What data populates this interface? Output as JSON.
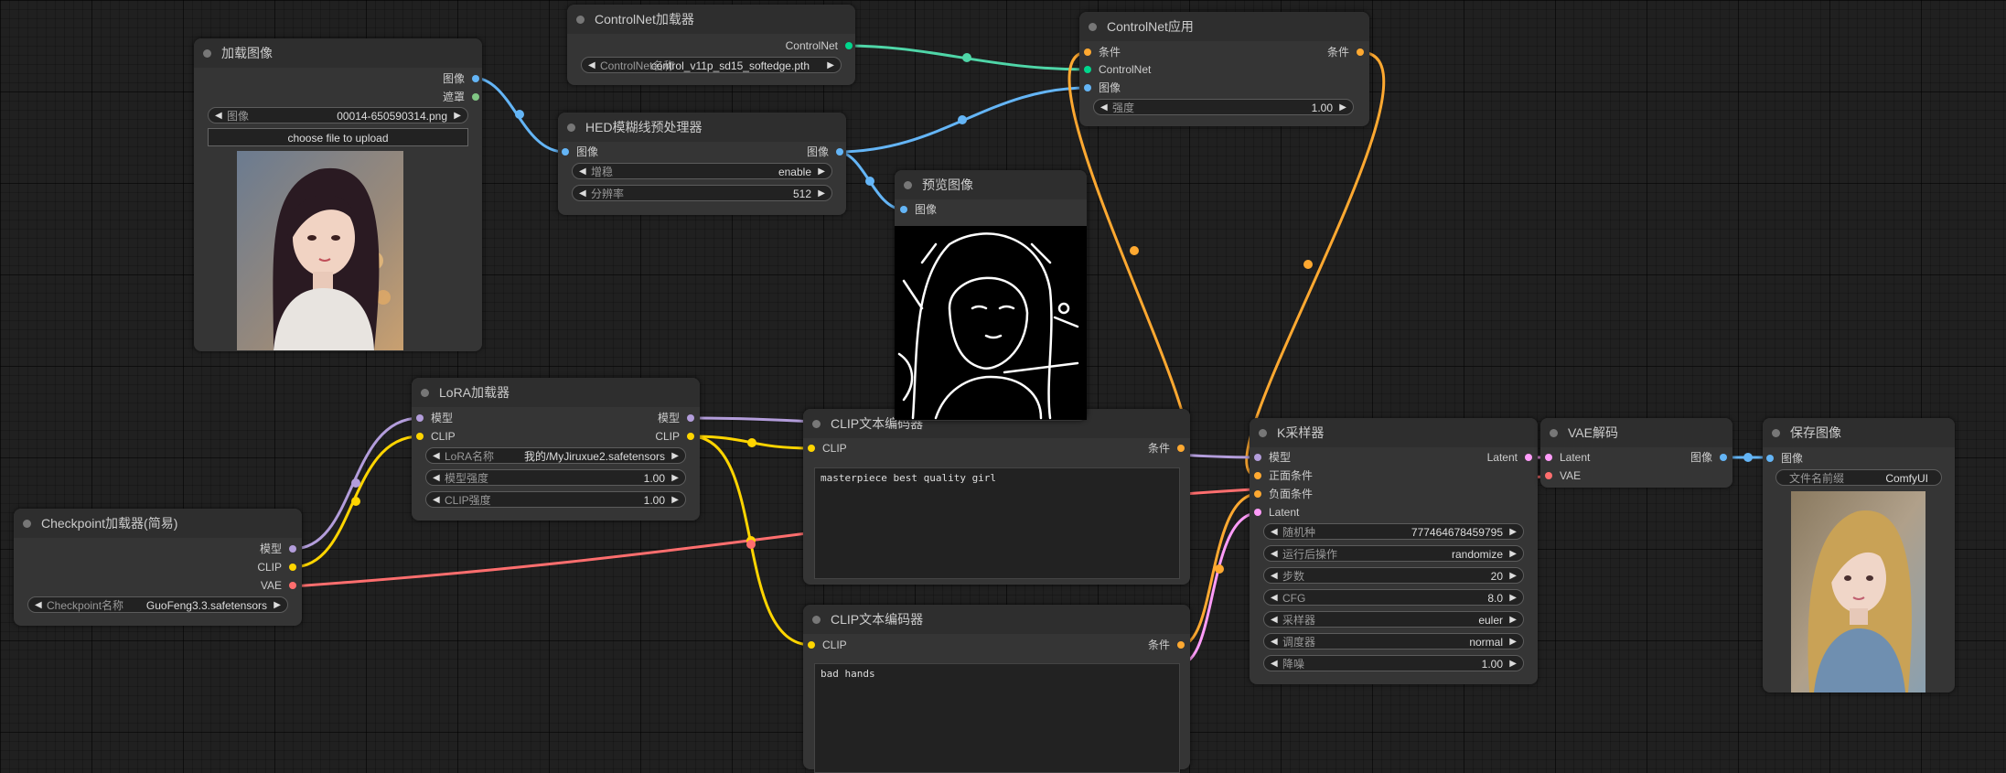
{
  "colors": {
    "canvas": "#202020",
    "node_body": "#353535",
    "image": "#64b5f6",
    "mask": "#81c784",
    "controlnet": "#00d78d",
    "conditioning": "#ffa931",
    "model": "#b39ddb",
    "clip": "#ffd500",
    "vae": "#ff6e6e",
    "latent": "#ff9cf9"
  },
  "load_image": {
    "title": "加载图像",
    "out_image": "图像",
    "out_mask": "遮罩",
    "image_label": "图像",
    "image_value": "00014-650590314.png",
    "upload_label": "choose file to upload"
  },
  "controlnet_loader": {
    "title": "ControlNet加载器",
    "out_controlnet": "ControlNet",
    "name_label": "ControlNet名称",
    "name_value": "control_v11p_sd15_softedge.pth"
  },
  "hed": {
    "title": "HED模糊线预处理器",
    "in_image": "图像",
    "out_image": "图像",
    "safe_label": "增稳",
    "safe_value": "enable",
    "res_label": "分辨率",
    "res_value": "512"
  },
  "preview": {
    "title": "预览图像",
    "in_image": "图像"
  },
  "controlnet_apply": {
    "title": "ControlNet应用",
    "in_cond": "条件",
    "in_controlnet": "ControlNet",
    "in_image": "图像",
    "out_cond": "条件",
    "strength_label": "强度",
    "strength_value": "1.00"
  },
  "lora": {
    "title": "LoRA加载器",
    "in_model": "模型",
    "in_clip": "CLIP",
    "out_model": "模型",
    "out_clip": "CLIP",
    "name_label": "LoRA名称",
    "name_value": "我的/MyJiruxue2.safetensors",
    "model_strength_label": "模型强度",
    "model_strength_value": "1.00",
    "clip_strength_label": "CLIP强度",
    "clip_strength_value": "1.00"
  },
  "checkpoint": {
    "title": "Checkpoint加载器(简易)",
    "out_model": "模型",
    "out_clip": "CLIP",
    "out_vae": "VAE",
    "name_label": "Checkpoint名称",
    "name_value": "GuoFeng3.3.safetensors"
  },
  "clip_pos": {
    "title": "CLIP文本编码器",
    "in_clip": "CLIP",
    "out_cond": "条件",
    "text": "masterpiece best quality girl"
  },
  "clip_neg": {
    "title": "CLIP文本编码器",
    "in_clip": "CLIP",
    "out_cond": "条件",
    "text": "bad hands"
  },
  "ksampler": {
    "title": "K采样器",
    "in_model": "模型",
    "in_positive": "正面条件",
    "in_negative": "负面条件",
    "in_latent": "Latent",
    "out_latent": "Latent",
    "seed_label": "随机种",
    "seed_value": "777464678459795",
    "control_label": "运行后操作",
    "control_value": "randomize",
    "steps_label": "步数",
    "steps_value": "20",
    "cfg_label": "CFG",
    "cfg_value": "8.0",
    "sampler_label": "采样器",
    "sampler_value": "euler",
    "scheduler_label": "调度器",
    "scheduler_value": "normal",
    "denoise_label": "降噪",
    "denoise_value": "1.00"
  },
  "vae_decode": {
    "title": "VAE解码",
    "in_latent": "Latent",
    "in_vae": "VAE",
    "out_image": "图像"
  },
  "save_image": {
    "title": "保存图像",
    "in_image": "图像",
    "prefix_label": "文件名前缀",
    "prefix_value": "ComfyUI"
  }
}
